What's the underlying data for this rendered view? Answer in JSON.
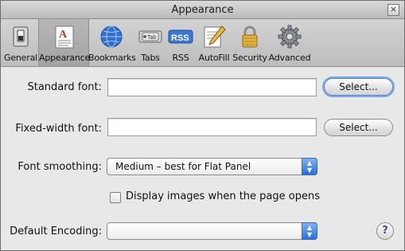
{
  "window": {
    "title": "Appearance"
  },
  "toolbar": {
    "items": [
      {
        "label": "General",
        "icon": "general-switch-icon"
      },
      {
        "label": "Appearance",
        "icon": "appearance-font-icon"
      },
      {
        "label": "Bookmarks",
        "icon": "bookmarks-globe-icon"
      },
      {
        "label": "Tabs",
        "icon": "tabs-icon",
        "icon_text": "Tab"
      },
      {
        "label": "RSS",
        "icon": "rss-icon",
        "icon_text": "RSS"
      },
      {
        "label": "AutoFill",
        "icon": "autofill-pencil-icon"
      },
      {
        "label": "Security",
        "icon": "security-lock-icon"
      },
      {
        "label": "Advanced",
        "icon": "advanced-gear-icon"
      }
    ],
    "selected": "Appearance"
  },
  "standard_font": {
    "label": "Standard font:",
    "value": "",
    "button": "Select..."
  },
  "fixed_font": {
    "label": "Fixed-width font:",
    "value": "",
    "button": "Select..."
  },
  "font_smoothing": {
    "label": "Font smoothing:",
    "value": "Medium – best for Flat Panel"
  },
  "display_images": {
    "label": "Display images when the page opens",
    "checked": false
  },
  "default_encoding": {
    "label": "Default Encoding:",
    "value": ""
  },
  "help": {
    "symbol": "?"
  },
  "colors": {
    "accent": "#2b6fd8",
    "focus_ring": "#7aa7e6"
  }
}
